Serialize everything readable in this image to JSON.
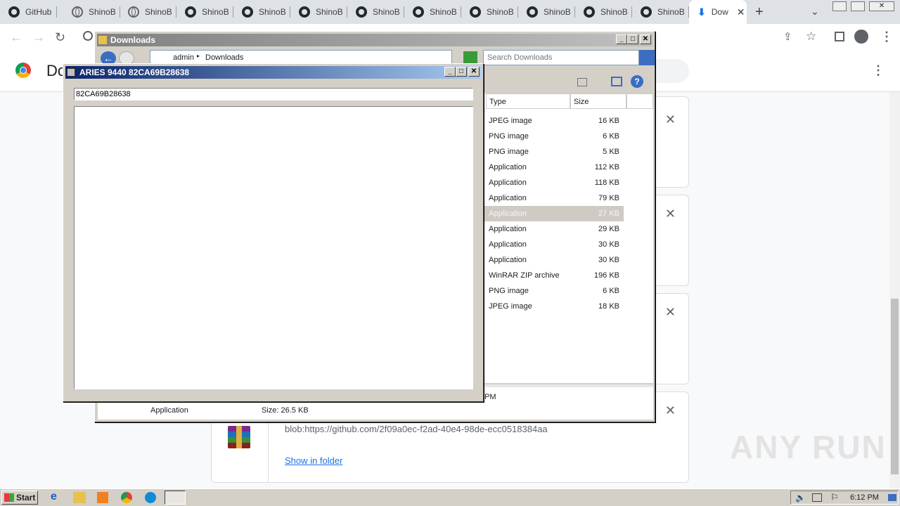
{
  "browser": {
    "tabs": [
      {
        "label": "GitHub -",
        "icon": "github-icon"
      },
      {
        "label": "ShinoBO",
        "icon": "globe-icon"
      },
      {
        "label": "ShinoBO",
        "icon": "globe-icon"
      },
      {
        "label": "ShinoBO",
        "icon": "github-icon"
      },
      {
        "label": "ShinoBO",
        "icon": "github-icon"
      },
      {
        "label": "ShinoBO",
        "icon": "github-icon"
      },
      {
        "label": "ShinoBO",
        "icon": "github-icon"
      },
      {
        "label": "ShinoBO",
        "icon": "github-icon"
      },
      {
        "label": "ShinoBO",
        "icon": "github-icon"
      },
      {
        "label": "ShinoBO",
        "icon": "github-icon"
      },
      {
        "label": "ShinoBO",
        "icon": "github-icon"
      },
      {
        "label": "ShinoBO",
        "icon": "github-icon"
      }
    ],
    "active_tab": {
      "label": "Dow",
      "icon": "download-icon"
    },
    "page_title_partial": "Do"
  },
  "downloads_card": {
    "url": "blob:https://github.com/2f09a0ec-f2ad-40e4-98de-ecc0518384aa",
    "show_in_folder": "Show in folder"
  },
  "explorer": {
    "title": "Downloads",
    "breadcrumb": [
      "admin",
      "Downloads"
    ],
    "search_placeholder": "Search Downloads",
    "columns": {
      "type": "Type",
      "size": "Size"
    },
    "rows": [
      {
        "type": "JPEG image",
        "size": "16 KB"
      },
      {
        "type": "PNG image",
        "size": "6 KB"
      },
      {
        "type": "PNG image",
        "size": "5 KB"
      },
      {
        "type": "Application",
        "size": "112 KB"
      },
      {
        "type": "Application",
        "size": "118 KB"
      },
      {
        "type": "Application",
        "size": "79 KB"
      },
      {
        "type": "Application",
        "size": "27 KB",
        "selected": true
      },
      {
        "type": "Application",
        "size": "29 KB"
      },
      {
        "type": "Application",
        "size": "30 KB"
      },
      {
        "type": "Application",
        "size": "30 KB"
      },
      {
        "type": "WinRAR ZIP archive",
        "size": "196 KB"
      },
      {
        "type": "PNG image",
        "size": "6 KB"
      },
      {
        "type": "JPEG image",
        "size": "18 KB"
      }
    ],
    "details": {
      "type": "Application",
      "size": "Size: 26.5 KB",
      "time_partial": "PM"
    }
  },
  "aries": {
    "title": "ARIES 9440 82CA69B28638",
    "input_value": "82CA69B28638"
  },
  "taskbar": {
    "start": "Start",
    "clock": "6:12 PM"
  },
  "watermark": "ANY RUN",
  "colors": {
    "xp_title_left": "#0a246a",
    "xp_title_right": "#a6caf0",
    "win_face": "#d4d0c8",
    "link": "#1a73e8"
  }
}
